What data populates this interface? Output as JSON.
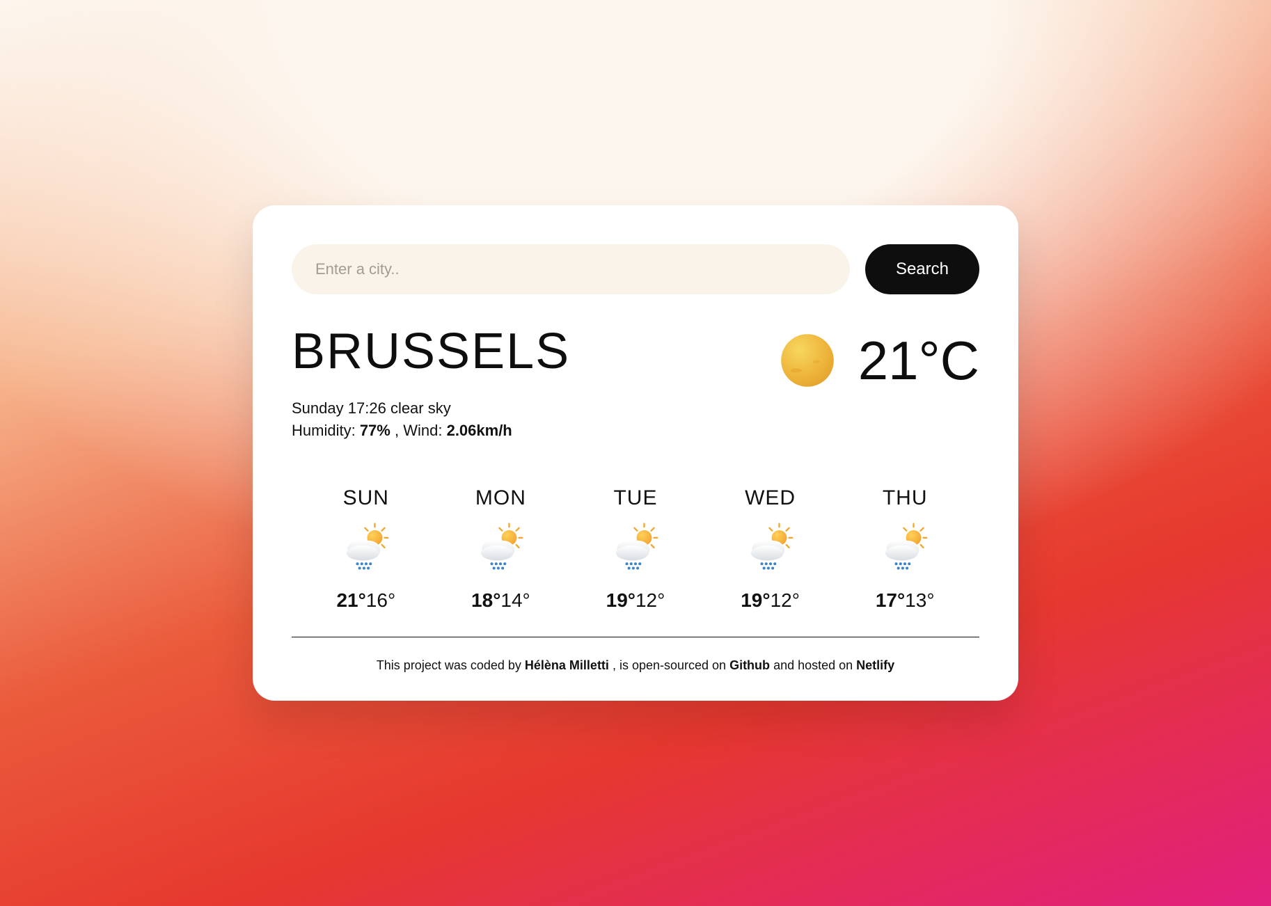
{
  "search": {
    "placeholder": "Enter a city..",
    "button": "Search"
  },
  "current": {
    "city": "BRUSSELS",
    "temp_display": "21°C",
    "icon": "clear-sun",
    "line1_day": "Sunday",
    "line1_time": "17:26",
    "line1_desc": "clear sky",
    "humidity_label": "Humidity:",
    "humidity_value": "77%",
    "wind_label": ", Wind:",
    "wind_value": "2.06km/h"
  },
  "forecast": [
    {
      "day": "SUN",
      "icon": "rain-sun",
      "hi": "21°",
      "lo": "16°"
    },
    {
      "day": "MON",
      "icon": "rain-sun",
      "hi": "18°",
      "lo": "14°"
    },
    {
      "day": "TUE",
      "icon": "rain-sun",
      "hi": "19°",
      "lo": "12°"
    },
    {
      "day": "WED",
      "icon": "rain-sun",
      "hi": "19°",
      "lo": "12°"
    },
    {
      "day": "THU",
      "icon": "rain-sun",
      "hi": "17°",
      "lo": "13°"
    }
  ],
  "footer": {
    "t1": "This project was coded by ",
    "author": "Hélèna Milletti",
    "t2": ", is open-sourced on ",
    "link1": "Github",
    "t3": " and hosted on ",
    "link2": "Netlify"
  }
}
